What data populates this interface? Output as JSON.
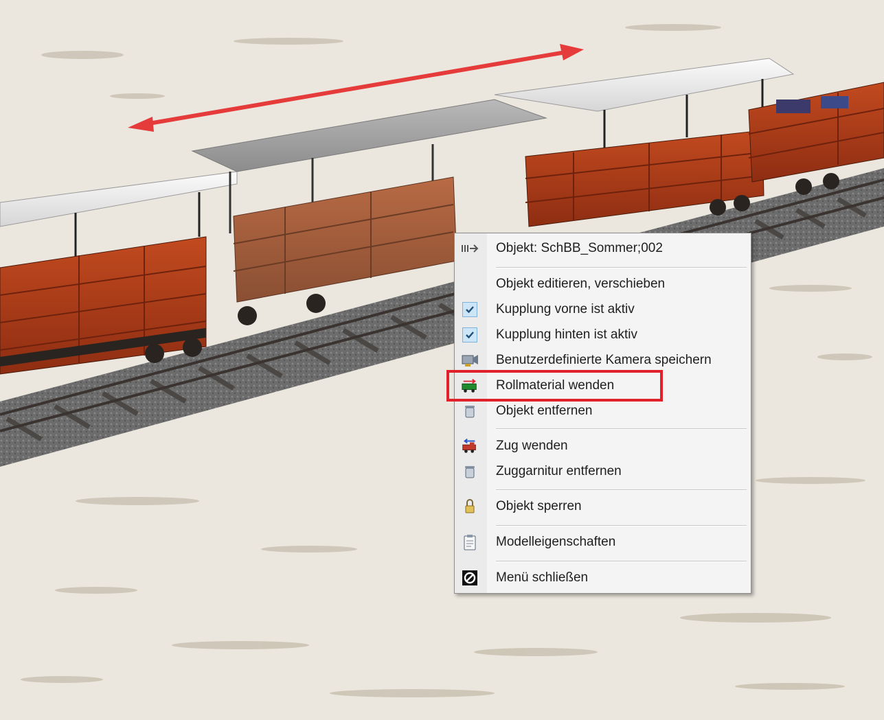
{
  "context_menu": {
    "items": [
      {
        "label": "Objekt: SchBB_Sommer;002",
        "icon": "object-arrow-icon"
      },
      {
        "label": "Objekt editieren, verschieben",
        "icon": ""
      },
      {
        "label": "Kupplung vorne ist aktiv",
        "icon": "checkbox-checked-icon",
        "checked": true
      },
      {
        "label": "Kupplung hinten ist aktiv",
        "icon": "checkbox-checked-icon",
        "checked": true
      },
      {
        "label": "Benutzerdefinierte Kamera speichern",
        "icon": "camera-icon"
      },
      {
        "label": "Rollmaterial wenden",
        "icon": "rolling-stock-turn-icon"
      },
      {
        "label": "Objekt entfernen",
        "icon": "trash-icon"
      },
      {
        "label": "Zug wenden",
        "icon": "train-turn-icon"
      },
      {
        "label": "Zuggarnitur entfernen",
        "icon": "trash-icon"
      },
      {
        "label": "Objekt sperren",
        "icon": "padlock-icon"
      },
      {
        "label": "Modelleigenschaften",
        "icon": "clipboard-icon"
      },
      {
        "label": "Menü schließen",
        "icon": "close-circle-icon"
      }
    ],
    "highlighted_item": "Rollmaterial wenden"
  },
  "colors": {
    "highlight_border": "#e0202a",
    "wagon_red": "#b0401c",
    "roof_white": "#f2f2f2",
    "ground_snow": "#ece8df",
    "direction_arrow": "#e53b3b"
  }
}
